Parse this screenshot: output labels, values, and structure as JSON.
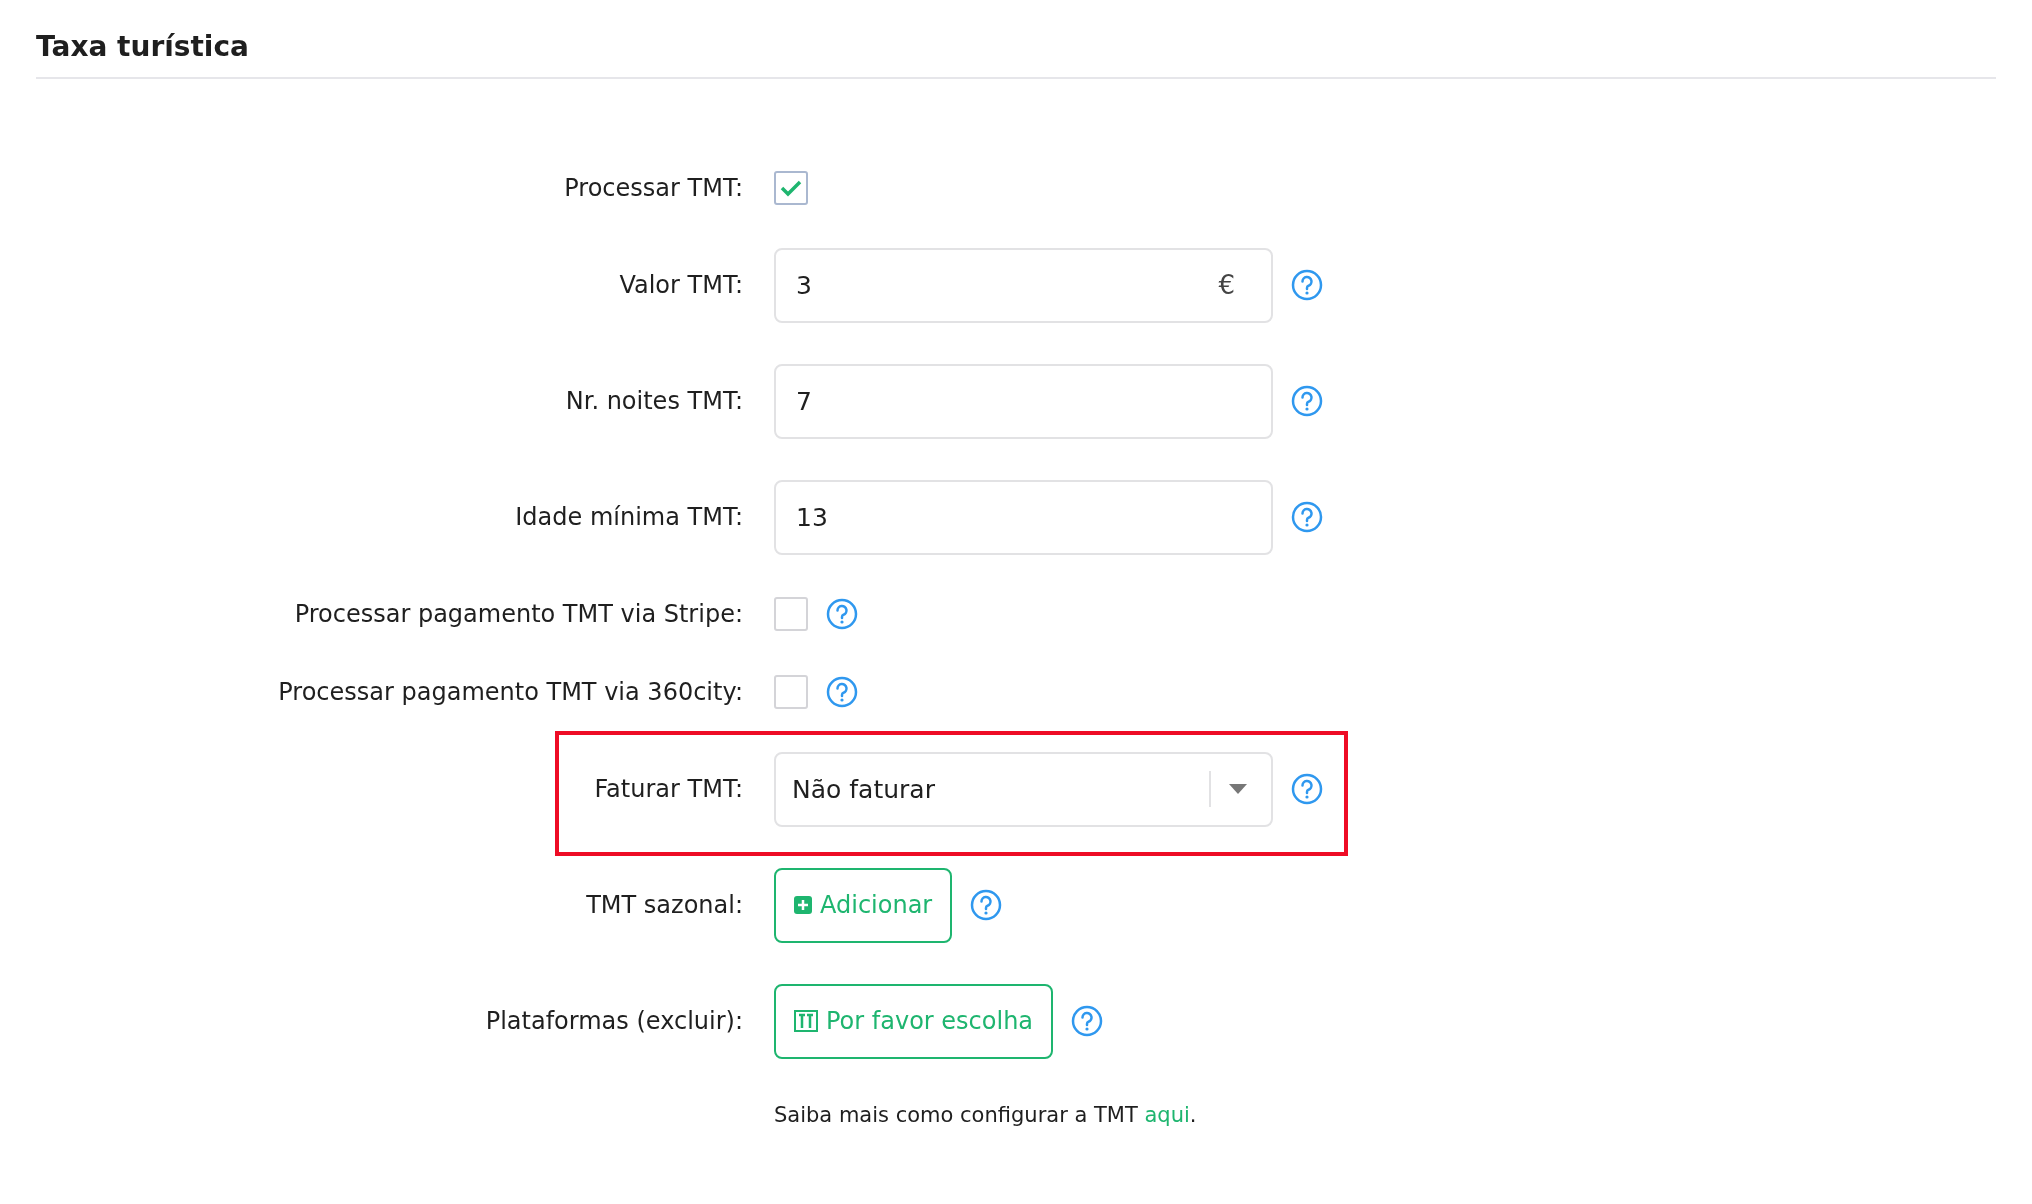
{
  "title": "Taxa turística",
  "rows": [
    {
      "kind": "checkbox",
      "label": "Processar TMT:",
      "checked": true,
      "help": false
    },
    {
      "kind": "input",
      "label": "Valor TMT:",
      "value": "3",
      "suffix": "€",
      "help": true
    },
    {
      "kind": "input",
      "label": "Nr. noites TMT:",
      "value": "7",
      "help": true
    },
    {
      "kind": "input",
      "label": "Idade mínima TMT:",
      "value": "13",
      "help": true
    },
    {
      "kind": "checkbox",
      "label": "Processar pagamento TMT via Stripe:",
      "checked": false,
      "help": true
    },
    {
      "kind": "checkbox",
      "label": "Processar pagamento TMT via 360city:",
      "checked": false,
      "help": true
    },
    {
      "kind": "select",
      "label": "Faturar TMT:",
      "value": "Não faturar",
      "highlighted": true,
      "help": true
    },
    {
      "kind": "add_button",
      "label": "TMT sazonal:",
      "button": "Adicionar",
      "help": true
    },
    {
      "kind": "picker_button",
      "label": "Plataformas (excluir):",
      "button": "Por favor escolha",
      "help": true
    }
  ],
  "note": {
    "text": "Saiba mais como configurar a TMT",
    "link": "aqui",
    "end": "."
  }
}
